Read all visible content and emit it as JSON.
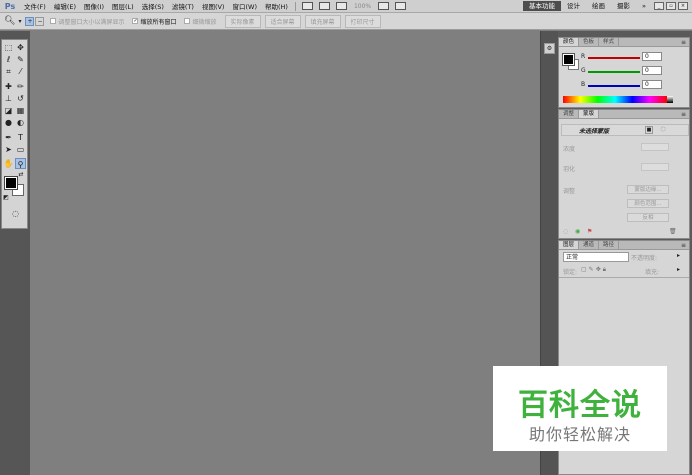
{
  "app": {
    "logo": "Ps"
  },
  "menu": {
    "items": [
      "文件(F)",
      "编辑(E)",
      "图像(I)",
      "图层(L)",
      "选择(S)",
      "滤镜(T)",
      "视图(V)",
      "窗口(W)",
      "帮助(H)"
    ],
    "zoom": "100%"
  },
  "workspaces": {
    "items": [
      "基本功能",
      "设计",
      "绘画",
      "摄影"
    ],
    "more": "»"
  },
  "options": {
    "checkboxes": [
      {
        "label": "调整窗口大小以满屏显示",
        "checked": false
      },
      {
        "label": "缩放所有窗口",
        "checked": true
      },
      {
        "label": "细微缩放",
        "checked": false
      }
    ],
    "buttons": [
      "实际像素",
      "适合屏幕",
      "填充屏幕",
      "打印尺寸"
    ]
  },
  "color_panel": {
    "tabs": [
      "颜色",
      "色板",
      "样式"
    ],
    "channels": [
      {
        "label": "R",
        "value": "0",
        "color": "#c00000"
      },
      {
        "label": "G",
        "value": "0",
        "color": "#009a00"
      },
      {
        "label": "B",
        "value": "0",
        "color": "#0000c0"
      }
    ]
  },
  "mask_panel": {
    "tabs": [
      "调整",
      "蒙版"
    ],
    "title": "未选择蒙版",
    "density_label": "浓度",
    "feather_label": "羽化",
    "refine_label": "调整",
    "buttons": [
      "蒙版边缘...",
      "颜色范围...",
      "反相"
    ]
  },
  "layers_panel": {
    "tabs": [
      "图层",
      "通道",
      "路径"
    ],
    "blend_mode": "正常",
    "opacity_label": "不透明度:",
    "lock_label": "锁定:",
    "fill_label": "填充:"
  },
  "watermark": {
    "title": "百科全说",
    "subtitle": "助你轻松解决"
  },
  "colors": {
    "accent": "#3fb13d",
    "workspace_active": "#4d4d4d"
  }
}
